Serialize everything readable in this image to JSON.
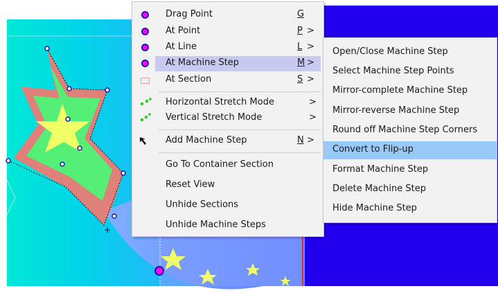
{
  "colors": {
    "workspace_gradient_start": "#00c9c9",
    "workspace_gradient_end": "#3aa0ff",
    "right_background": "#2200ee",
    "star_fill": "#f0ff66",
    "star_outline": "#e0807a",
    "star_inner": "#55ee77",
    "band": "#6688ff",
    "menu_bg": "#f2f2f2",
    "menu_highlight": "#c7c9f0",
    "submenu_highlight": "#99c9f6",
    "point_marker": "#ff00ff"
  },
  "context_menu": {
    "items": [
      {
        "label": "Drag Point",
        "shortcut": "G",
        "arrow": "",
        "icon": "magenta-dot-icon"
      },
      {
        "label": "At Point",
        "shortcut": "P",
        "arrow": ">",
        "icon": "magenta-dot-icon"
      },
      {
        "label": "At Line",
        "shortcut": "L",
        "arrow": ">",
        "icon": "magenta-dot-icon"
      },
      {
        "label": "At Machine Step",
        "shortcut": "M",
        "arrow": ">",
        "icon": "magenta-dot-icon",
        "highlighted": true
      },
      {
        "label": "At Section",
        "shortcut": "S",
        "arrow": ">",
        "icon": "section-rect-icon"
      },
      {
        "label": "Horizontal Stretch Mode",
        "shortcut": "",
        "arrow": ">",
        "icon": "green-dots-icon"
      },
      {
        "label": "Vertical Stretch Mode",
        "shortcut": "",
        "arrow": ">",
        "icon": "green-dots-icon"
      },
      {
        "label": "Add Machine Step",
        "shortcut": "N",
        "arrow": ">",
        "icon": "arrow-cursor-icon"
      },
      {
        "label": "Go To Container Section",
        "shortcut": "",
        "arrow": ""
      },
      {
        "label": "Reset View",
        "shortcut": "",
        "arrow": ""
      },
      {
        "label": "Unhide Sections",
        "shortcut": "",
        "arrow": ""
      },
      {
        "label": "Unhide Machine Steps",
        "shortcut": "",
        "arrow": ""
      }
    ]
  },
  "submenu": {
    "items": [
      {
        "label": "Open/Close Machine Step"
      },
      {
        "label": "Select Machine Step Points"
      },
      {
        "label": "Mirror-complete Machine Step"
      },
      {
        "label": "Mirror-reverse Machine Step"
      },
      {
        "label": "Round off Machine Step Corners"
      },
      {
        "label": "Convert to Flip-up",
        "highlighted": true
      },
      {
        "label": "Format Machine Step"
      },
      {
        "label": "Delete Machine Step"
      },
      {
        "label": "Hide Machine Step"
      }
    ]
  }
}
